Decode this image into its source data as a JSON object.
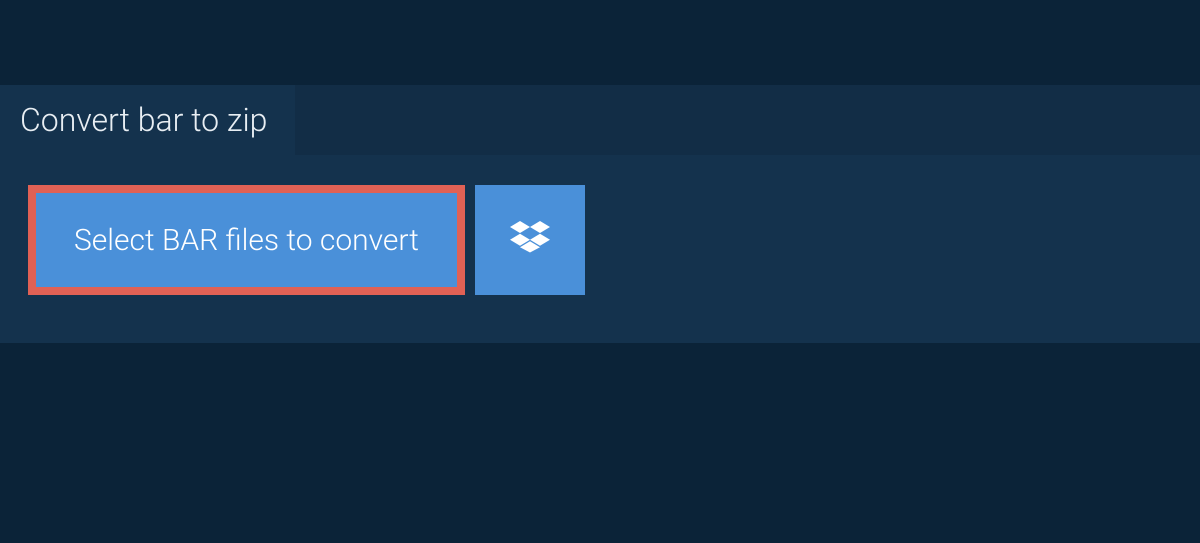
{
  "tab": {
    "title": "Convert bar to zip"
  },
  "actions": {
    "select_label": "Select BAR files to convert"
  }
}
